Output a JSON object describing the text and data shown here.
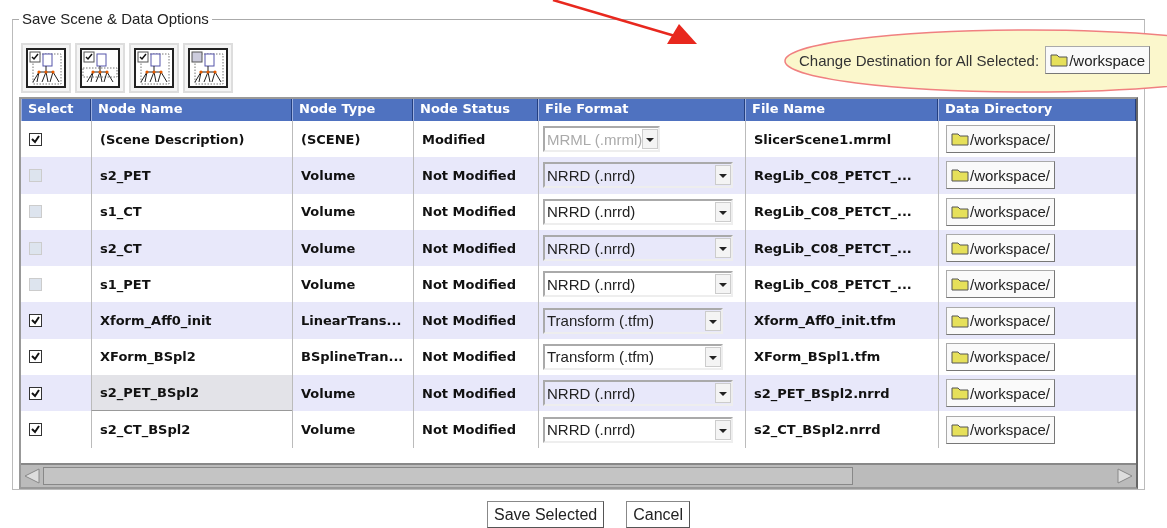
{
  "panel": {
    "title": "Save Scene & Data Options"
  },
  "destination": {
    "label": "Change Destination for All Selected:",
    "value": "/workspace"
  },
  "table": {
    "columns": [
      "Select",
      "Node Name",
      "Node Type",
      "Node Status",
      "File Format",
      "File Name",
      "Data Directory"
    ],
    "rows": [
      {
        "checked": true,
        "selected": false,
        "name": "(Scene Description)",
        "type": "(SCENE)",
        "status": "Modified",
        "format": "MRML (.mrml)",
        "format_disabled": true,
        "file": "SlicerScene1.mrml",
        "directory": "/workspace/"
      },
      {
        "checked": false,
        "selected": false,
        "name": "s2_PET",
        "type": "Volume",
        "status": "Not Modified",
        "format": "NRRD (.nrrd)",
        "format_disabled": false,
        "file": "RegLib_C08_PETCT_...",
        "directory": "/workspace/"
      },
      {
        "checked": false,
        "selected": false,
        "name": "s1_CT",
        "type": "Volume",
        "status": "Not Modified",
        "format": "NRRD (.nrrd)",
        "format_disabled": false,
        "file": "RegLib_C08_PETCT_...",
        "directory": "/workspace/"
      },
      {
        "checked": false,
        "selected": false,
        "name": "s2_CT",
        "type": "Volume",
        "status": "Not Modified",
        "format": "NRRD (.nrrd)",
        "format_disabled": false,
        "file": "RegLib_C08_PETCT_...",
        "directory": "/workspace/"
      },
      {
        "checked": false,
        "selected": false,
        "name": "s1_PET",
        "type": "Volume",
        "status": "Not Modified",
        "format": "NRRD (.nrrd)",
        "format_disabled": false,
        "file": "RegLib_C08_PETCT_...",
        "directory": "/workspace/"
      },
      {
        "checked": true,
        "selected": false,
        "name": "Xform_Aff0_init",
        "type": "LinearTrans...",
        "status": "Not Modified",
        "format": "Transform (.tfm)",
        "format_disabled": false,
        "file": "Xform_Aff0_init.tfm",
        "directory": "/workspace/"
      },
      {
        "checked": true,
        "selected": false,
        "name": "XForm_BSpl2",
        "type": "BSplineTran...",
        "status": "Not Modified",
        "format": "Transform (.tfm)",
        "format_disabled": false,
        "file": "XForm_BSpl1.tfm",
        "directory": "/workspace/"
      },
      {
        "checked": true,
        "selected": true,
        "name": "s2_PET_BSpl2",
        "type": "Volume",
        "status": "Not Modified",
        "format": "NRRD (.nrrd)",
        "format_disabled": false,
        "file": "s2_PET_BSpl2.nrrd",
        "directory": "/workspace/"
      },
      {
        "checked": true,
        "selected": false,
        "name": "s2_CT_BSpl2",
        "type": "Volume",
        "status": "Not Modified",
        "format": "NRRD (.nrrd)",
        "format_disabled": false,
        "file": "s2_CT_BSpl2.nrrd",
        "directory": "/workspace/"
      }
    ]
  },
  "buttons": [
    "Save Selected",
    "Cancel"
  ]
}
